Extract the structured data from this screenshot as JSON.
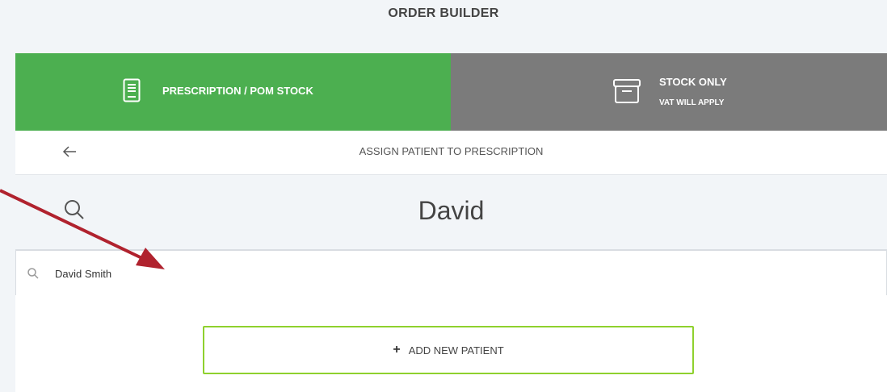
{
  "page": {
    "title": "ORDER BUILDER"
  },
  "tabs": [
    {
      "label": "PRESCRIPTION / POM STOCK",
      "sub": "",
      "icon": "document-icon",
      "active": true,
      "color": "#4caf50"
    },
    {
      "label": "STOCK ONLY",
      "sub": "VAT WILL APPLY",
      "icon": "archive-box-icon",
      "active": false,
      "color": "#7b7b7b"
    }
  ],
  "header": {
    "back_icon": "arrow-left-icon",
    "title": "ASSIGN PATIENT TO PRESCRIPTION"
  },
  "search": {
    "icon": "search-icon",
    "value": "David"
  },
  "results": [
    {
      "icon": "search-icon",
      "text": "David Smith"
    }
  ],
  "actions": {
    "add_patient_label": "ADD NEW PATIENT",
    "add_patient_icon": "plus-icon",
    "border_color": "#8fd12e"
  },
  "annotation": {
    "arrow_color": "#b0222e"
  }
}
